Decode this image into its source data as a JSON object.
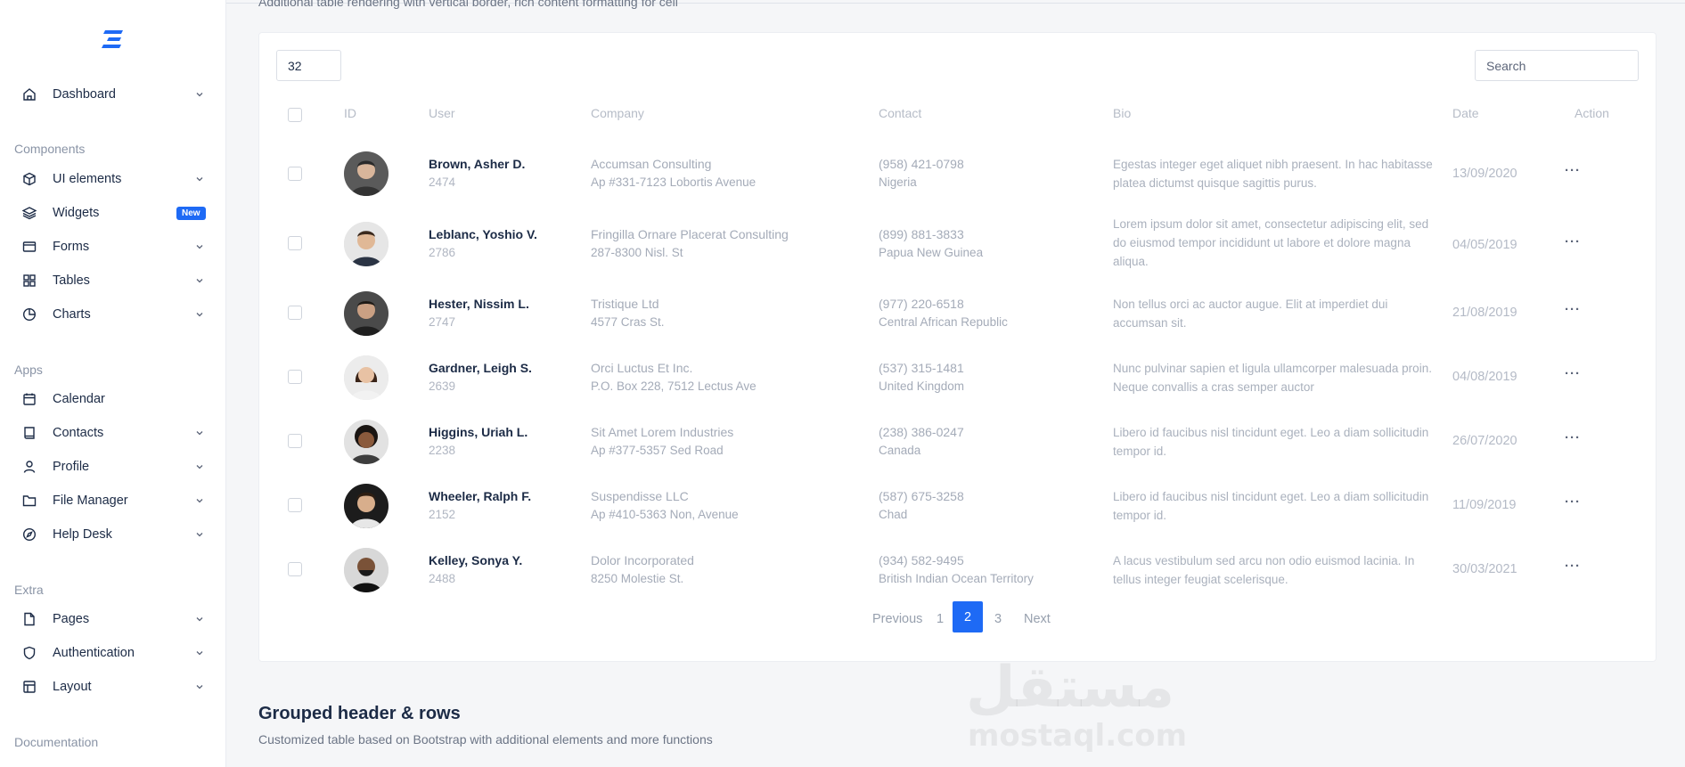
{
  "brand": {
    "logo_icon": "brand-logo-icon",
    "accent": "#1e6af5"
  },
  "sidebar": {
    "top_items": [
      {
        "label": "Dashboard",
        "icon": "home-icon",
        "has_chevron": true
      }
    ],
    "sections": [
      {
        "title": "Components",
        "items": [
          {
            "label": "UI elements",
            "icon": "cube-icon",
            "has_chevron": true
          },
          {
            "label": "Widgets",
            "icon": "layers-icon",
            "badge": "New"
          },
          {
            "label": "Forms",
            "icon": "form-icon",
            "has_chevron": true
          },
          {
            "label": "Tables",
            "icon": "grid-icon",
            "has_chevron": true
          },
          {
            "label": "Charts",
            "icon": "pie-chart-icon",
            "has_chevron": true
          }
        ]
      },
      {
        "title": "Apps",
        "items": [
          {
            "label": "Calendar",
            "icon": "calendar-icon"
          },
          {
            "label": "Contacts",
            "icon": "book-icon",
            "has_chevron": true
          },
          {
            "label": "Profile",
            "icon": "user-icon",
            "has_chevron": true
          },
          {
            "label": "File Manager",
            "icon": "folder-icon",
            "has_chevron": true
          },
          {
            "label": "Help Desk",
            "icon": "compass-icon",
            "has_chevron": true
          }
        ]
      },
      {
        "title": "Extra",
        "items": [
          {
            "label": "Pages",
            "icon": "file-icon",
            "has_chevron": true
          },
          {
            "label": "Authentication",
            "icon": "shield-icon",
            "has_chevron": true
          },
          {
            "label": "Layout",
            "icon": "layout-icon",
            "has_chevron": true
          }
        ]
      },
      {
        "title": "Documentation",
        "items": []
      }
    ]
  },
  "page": {
    "cut_subtitle": "Additional table rendering with vertical border, rich content formatting for cell"
  },
  "table": {
    "page_length": "32",
    "search_placeholder": "Search",
    "columns": [
      "ID",
      "User",
      "Company",
      "Contact",
      "Bio",
      "Date",
      "Action"
    ],
    "rows": [
      {
        "name": "Brown, Asher D.",
        "id": "2474",
        "company": "Accumsan Consulting",
        "address": "Ap #331-7123 Lobortis Avenue",
        "phone": "(958) 421-0798",
        "country": "Nigeria",
        "bio": "Egestas integer eget aliquet nibh praesent. In hac habitasse platea dictumst quisque sagittis purus.",
        "date": "13/09/2020",
        "action": "···"
      },
      {
        "name": "Leblanc, Yoshio V.",
        "id": "2786",
        "company": "Fringilla Ornare Placerat Consulting",
        "address": "287-8300 Nisl. St",
        "phone": "(899) 881-3833",
        "country": "Papua New Guinea",
        "bio": "Lorem ipsum dolor sit amet, consectetur adipiscing elit, sed do eiusmod tempor incididunt ut labore et dolore magna aliqua.",
        "date": "04/05/2019",
        "action": "···"
      },
      {
        "name": "Hester, Nissim L.",
        "id": "2747",
        "company": "Tristique Ltd",
        "address": "4577 Cras St.",
        "phone": "(977) 220-6518",
        "country": "Central African Republic",
        "bio": "Non tellus orci ac auctor augue. Elit at imperdiet dui accumsan sit.",
        "date": "21/08/2019",
        "action": "···"
      },
      {
        "name": "Gardner, Leigh S.",
        "id": "2639",
        "company": "Orci Luctus Et Inc.",
        "address": "P.O. Box 228, 7512 Lectus Ave",
        "phone": "(537) 315-1481",
        "country": "United Kingdom",
        "bio": "Nunc pulvinar sapien et ligula ullamcorper malesuada proin. Neque convallis a cras semper auctor",
        "date": "04/08/2019",
        "action": "···"
      },
      {
        "name": "Higgins, Uriah L.",
        "id": "2238",
        "company": "Sit Amet Lorem Industries",
        "address": "Ap #377-5357 Sed Road",
        "phone": "(238) 386-0247",
        "country": "Canada",
        "bio": "Libero id faucibus nisl tincidunt eget. Leo a diam sollicitudin tempor id.",
        "date": "26/07/2020",
        "action": "···"
      },
      {
        "name": "Wheeler, Ralph F.",
        "id": "2152",
        "company": "Suspendisse LLC",
        "address": "Ap #410-5363 Non, Avenue",
        "phone": "(587) 675-3258",
        "country": "Chad",
        "bio": "Libero id faucibus nisl tincidunt eget. Leo a diam sollicitudin tempor id.",
        "date": "11/09/2019",
        "action": "···"
      },
      {
        "name": "Kelley, Sonya Y.",
        "id": "2488",
        "company": "Dolor Incorporated",
        "address": "8250 Molestie St.",
        "phone": "(934) 582-9495",
        "country": "British Indian Ocean Territory",
        "bio": "A lacus vestibulum sed arcu non odio euismod lacinia. In tellus integer feugiat scelerisque.",
        "date": "30/03/2021",
        "action": "···"
      }
    ],
    "pagination": {
      "previous": "Previous",
      "pages": [
        "1",
        "2",
        "3"
      ],
      "active": "2",
      "next": "Next"
    }
  },
  "next_section": {
    "title": "Grouped header & rows",
    "subtitle": "Customized table based on Bootstrap with additional elements and more functions"
  },
  "watermark": {
    "arabic": "مستقل",
    "latin": "mostaql.com"
  }
}
